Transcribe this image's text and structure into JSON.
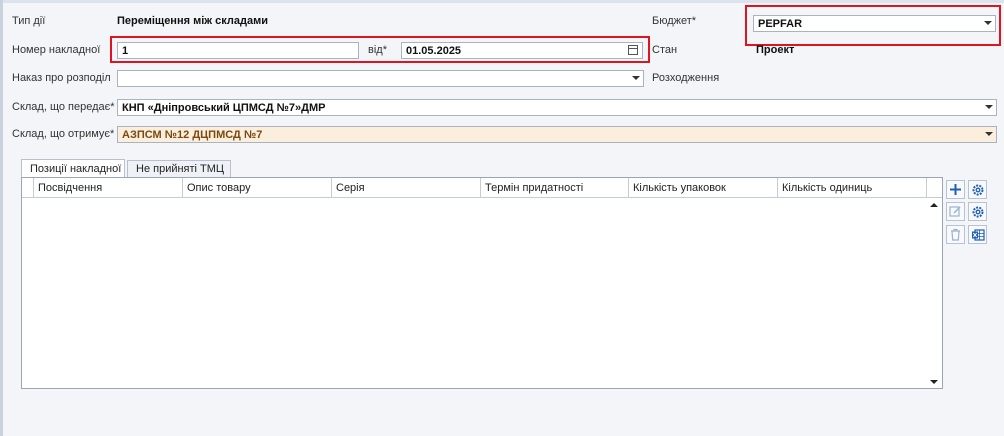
{
  "form": {
    "action_type_label": "Тип дії",
    "action_type_value": "Переміщення між складами",
    "invoice_number_label": "Номер накладної",
    "invoice_number_value": "1",
    "date_label": "від*",
    "date_value": "01.05.2025",
    "distribution_order_label": "Наказ про розподіл",
    "distribution_order_value": "",
    "sender_warehouse_label": "Склад, що передає*",
    "sender_warehouse_value": "КНП «Дніпровський ЦПМСД №7»ДМР",
    "receiver_warehouse_label": "Склад, що отримує*",
    "receiver_warehouse_value": "АЗПСМ №12 ДЦПМСД №7",
    "budget_label": "Бюджет*",
    "budget_value": "PEPFAR",
    "state_label": "Стан",
    "state_value": "Проект",
    "expense_label": "Розходження"
  },
  "tabs": [
    {
      "label": "Позиції накладної",
      "active": true
    },
    {
      "label": "Не прийняті ТМЦ",
      "active": false
    }
  ],
  "grid": {
    "columns": [
      "Посвідчення",
      "Опис товару",
      "Серія",
      "Термін придатності",
      "Кількість упаковок",
      "Кількість одиниць"
    ]
  },
  "toolbar": {
    "icons": [
      "plus-icon",
      "gear-icon",
      "edit-icon",
      "gear-icon",
      "trash-icon",
      "excel-icon"
    ]
  },
  "colors": {
    "highlight": "#e0141e",
    "accent": "#1e5db8",
    "receiver_bg": "#fbeedd"
  }
}
